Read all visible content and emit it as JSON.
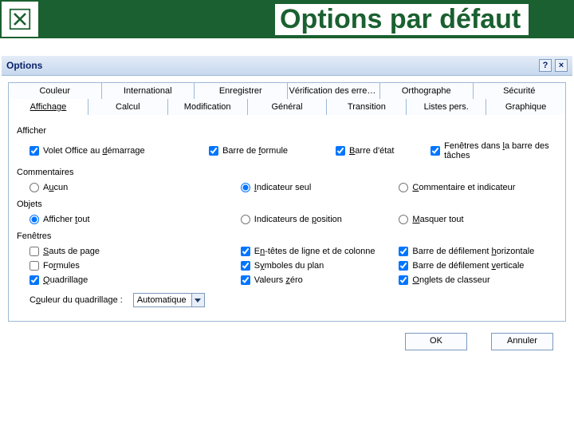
{
  "header": {
    "title": "Options par défaut"
  },
  "dialog": {
    "title": "Options",
    "help": "?",
    "close": "×",
    "tabs_row1": [
      "Couleur",
      "International",
      "Enregistrer",
      "Vérification des erreurs",
      "Orthographe",
      "Sécurité"
    ],
    "tabs_row2": [
      "Affichage",
      "Calcul",
      "Modification",
      "Général",
      "Transition",
      "Listes pers.",
      "Graphique"
    ],
    "active_tab": "Affichage"
  },
  "sections": {
    "afficher": {
      "label": "Afficher",
      "items": [
        "Volet Office au démarrage",
        "Barre de formule",
        "Barre d'état",
        "Fenêtres dans la barre des tâches"
      ]
    },
    "commentaires": {
      "label": "Commentaires",
      "items": [
        "Aucun",
        "Indicateur seul",
        "Commentaire et indicateur"
      ]
    },
    "objets": {
      "label": "Objets",
      "items": [
        "Afficher tout",
        "Indicateurs de position",
        "Masquer tout"
      ]
    },
    "fenetres": {
      "label": "Fenêtres",
      "col1": [
        "Sauts de page",
        "Formules",
        "Quadrillage"
      ],
      "col2": [
        "En-têtes de ligne et de colonne",
        "Symboles du plan",
        "Valeurs zéro"
      ],
      "col3": [
        "Barre de défilement horizontale",
        "Barre de défilement verticale",
        "Onglets de classeur"
      ],
      "grid_color_label": "Couleur du quadrillage :",
      "grid_color_value": "Automatique"
    }
  },
  "buttons": {
    "ok": "OK",
    "cancel": "Annuler"
  }
}
